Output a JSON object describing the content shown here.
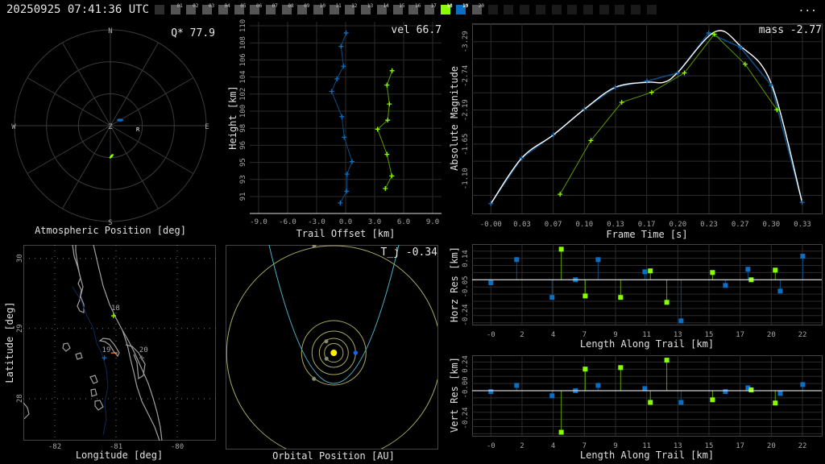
{
  "header": {
    "timestamp": "20250925 07:41:36 UTC",
    "more_label": "..."
  },
  "cameras": {
    "labels": [
      "",
      "01",
      "02",
      "03",
      "04",
      "05",
      "06",
      "07",
      "08",
      "09",
      "10",
      "11",
      "12",
      "13",
      "14",
      "15",
      "16",
      "17",
      "18",
      "19",
      "20",
      "",
      "",
      "",
      "",
      "",
      "",
      "",
      "",
      "",
      "",
      ""
    ],
    "states": [
      "idle",
      "avail",
      "avail",
      "avail",
      "avail",
      "avail",
      "avail",
      "avail",
      "avail",
      "avail",
      "avail",
      "avail",
      "avail",
      "avail",
      "avail",
      "avail",
      "avail",
      "avail",
      "green",
      "blue",
      "avail",
      "off",
      "off",
      "off",
      "off",
      "off",
      "off",
      "off",
      "off",
      "off",
      "off",
      "off"
    ],
    "colors": {
      "idle": "#2e2e2e",
      "avail": "#555555",
      "green": "#88ff00",
      "blue": "#0a6fc2",
      "off": "#1a1a1a"
    }
  },
  "colors": {
    "station_a": "#0a6fc2",
    "station_a_line": "#0c4c80",
    "station_b": "#88ff00",
    "station_b_line": "#5b9c00",
    "fit": "#ffffff",
    "grid": "#2c2c2c",
    "orbit_planet": "#a8a860",
    "orbit_meteor": "#4fb0c6",
    "sun": "#ffee00",
    "earth": "#1060ff",
    "coast": "#a0a0a0",
    "river": "#0c2a55",
    "marker_end": "#ff8030"
  },
  "polar": {
    "title": "Atmospheric Position [deg]",
    "annotation": "Q* 77.9",
    "cardinals": {
      "N": "N",
      "S": "S",
      "E": "E",
      "W": "W",
      "Z": "Z"
    },
    "rings_zenith_deg": [
      30,
      60,
      90
    ],
    "radiant_label": "R",
    "radiant": {
      "az": 97,
      "zd": 26
    },
    "track_a": {
      "az": 60,
      "zd": 10.5
    },
    "track_b": {
      "az": 178,
      "zd": 28.7
    }
  },
  "height_chart": {
    "annotation": "vel 66.7",
    "xlabel": "Trail Offset [km]",
    "ylabel": "Height [km]",
    "xticks": [
      "-9.0",
      "-6.0",
      "-3.0",
      "0.0",
      "3.0",
      "6.0",
      "9.0"
    ],
    "yticks": [
      "110",
      "108",
      "106",
      "104",
      "102",
      "100",
      "98",
      "96",
      "95",
      "93",
      "91"
    ],
    "series_a": {
      "offset": [
        0.03,
        -0.5,
        -0.25,
        -0.92,
        -1.47,
        -0.42,
        -0.17,
        0.64,
        0.12,
        0.08,
        -0.58
      ],
      "height": [
        109.2,
        107.7,
        105.5,
        104.1,
        102.7,
        99.9,
        97.6,
        94.9,
        93.5,
        91.6,
        90.3
      ]
    },
    "series_b": {
      "offset": [
        4.78,
        4.25,
        4.5,
        4.33,
        3.28,
        4.25,
        4.75,
        4.08
      ],
      "height": [
        105.0,
        103.4,
        101.3,
        99.5,
        98.5,
        95.7,
        93.3,
        91.9
      ]
    }
  },
  "chart_data": [
    {
      "type": "line",
      "annotation": "mass -2.77",
      "xlabel": "Frame Time [s]",
      "ylabel": "Absolute Magnitude",
      "xticks": [
        "-0.00",
        "0.03",
        "0.07",
        "0.10",
        "0.13",
        "0.17",
        "0.20",
        "0.23",
        "0.27",
        "0.30",
        "0.33"
      ],
      "yticks": [
        "-3.29",
        "-2.74",
        "-2.19",
        "-1.65",
        "-1.10"
      ],
      "series": [
        {
          "x": [
            0,
            0.033,
            0.067,
            0.1,
            0.133,
            0.167,
            0.2,
            0.233,
            0.267,
            0.3,
            0.333
          ],
          "y": [
            -0.7,
            -1.43,
            -1.8,
            -2.21,
            -2.56,
            -2.66,
            -2.79,
            -3.43,
            -3.2,
            -2.59,
            -0.72
          ]
        },
        {
          "x": [
            0.074,
            0.107,
            0.14,
            0.172,
            0.207,
            0.239,
            0.272,
            0.306
          ],
          "y": [
            -0.85,
            -1.71,
            -2.32,
            -2.48,
            -2.79,
            -3.41,
            -2.93,
            -2.2
          ]
        },
        {
          "x": [
            0,
            0.033,
            0.067,
            0.1,
            0.133,
            0.167,
            0.185,
            0.2,
            0.24,
            0.267,
            0.3,
            0.333
          ],
          "y": [
            -0.7,
            -1.43,
            -1.8,
            -2.21,
            -2.56,
            -2.64,
            -2.64,
            -2.8,
            -3.45,
            -3.22,
            -2.62,
            -0.72
          ]
        }
      ]
    },
    {
      "type": "scatter",
      "xlabel": "Length Along Trail [km]",
      "ylabel": "Horz Res [km]",
      "xticks": [
        "-0",
        "2",
        "4",
        "7",
        "9",
        "11",
        "13",
        "15",
        "17",
        "20",
        "22"
      ],
      "yticks": [
        "0.14",
        "-0.05",
        "-0.24"
      ],
      "series": [
        {
          "x": [
            0,
            1.82,
            4.32,
            5.97,
            7.57,
            10.87,
            13.43,
            16.56,
            18.15,
            20.43,
            22.02
          ],
          "y": [
            -0.02,
            0.136,
            -0.119,
            0,
            0.136,
            0.054,
            -0.277,
            -0.038,
            0.071,
            -0.076,
            0.159
          ]
        },
        {
          "x": [
            4.97,
            6.66,
            9.16,
            11.26,
            12.42,
            15.65,
            18.38,
            20.08
          ],
          "y": [
            0.206,
            -0.109,
            -0.119,
            0.06,
            -0.152,
            0.049,
            0,
            0.065
          ]
        }
      ]
    },
    {
      "type": "scatter",
      "xlabel": "Length Along Trail [km]",
      "ylabel": "Vert Res [km]",
      "xticks": [
        "-0",
        "2",
        "4",
        "7",
        "9",
        "11",
        "13",
        "15",
        "17",
        "20",
        "22"
      ],
      "yticks": [
        "0.24",
        "-0.00",
        "-0.24"
      ],
      "series": [
        {
          "x": [
            0,
            1.82,
            4.32,
            5.97,
            7.57,
            10.87,
            13.43,
            16.56,
            18.15,
            20.43,
            22.02
          ],
          "y": [
            -0.004,
            0.025,
            -0.024,
            0,
            0.025,
            0.01,
            -0.055,
            -0.004,
            0.014,
            -0.013,
            0.029
          ]
        },
        {
          "x": [
            4.97,
            6.66,
            9.16,
            11.26,
            12.42,
            15.65,
            18.38,
            20.08
          ],
          "y": [
            -0.196,
            0.102,
            0.109,
            -0.055,
            0.144,
            -0.043,
            0.004,
            -0.058
          ]
        }
      ]
    }
  ],
  "map": {
    "xlabel": "Longitude [deg]",
    "ylabel": "Latitude [deg]",
    "xticks": [
      "-82",
      "-81",
      "-80"
    ],
    "yticks": [
      "30",
      "29",
      "28"
    ],
    "station_a": {
      "label": "19",
      "lon": -81.19,
      "lat": 28.58
    },
    "station_b": {
      "label": "18",
      "lon": -81.04,
      "lat": 29.18
    },
    "end_point": {
      "label": "20",
      "lon": -80.58,
      "lat": 28.58
    },
    "trail_end": {
      "lon": -81.03,
      "lat": 28.65
    }
  },
  "orbit": {
    "xlabel": "Orbital Position [AU]",
    "annotation": "T_j -0.34"
  }
}
